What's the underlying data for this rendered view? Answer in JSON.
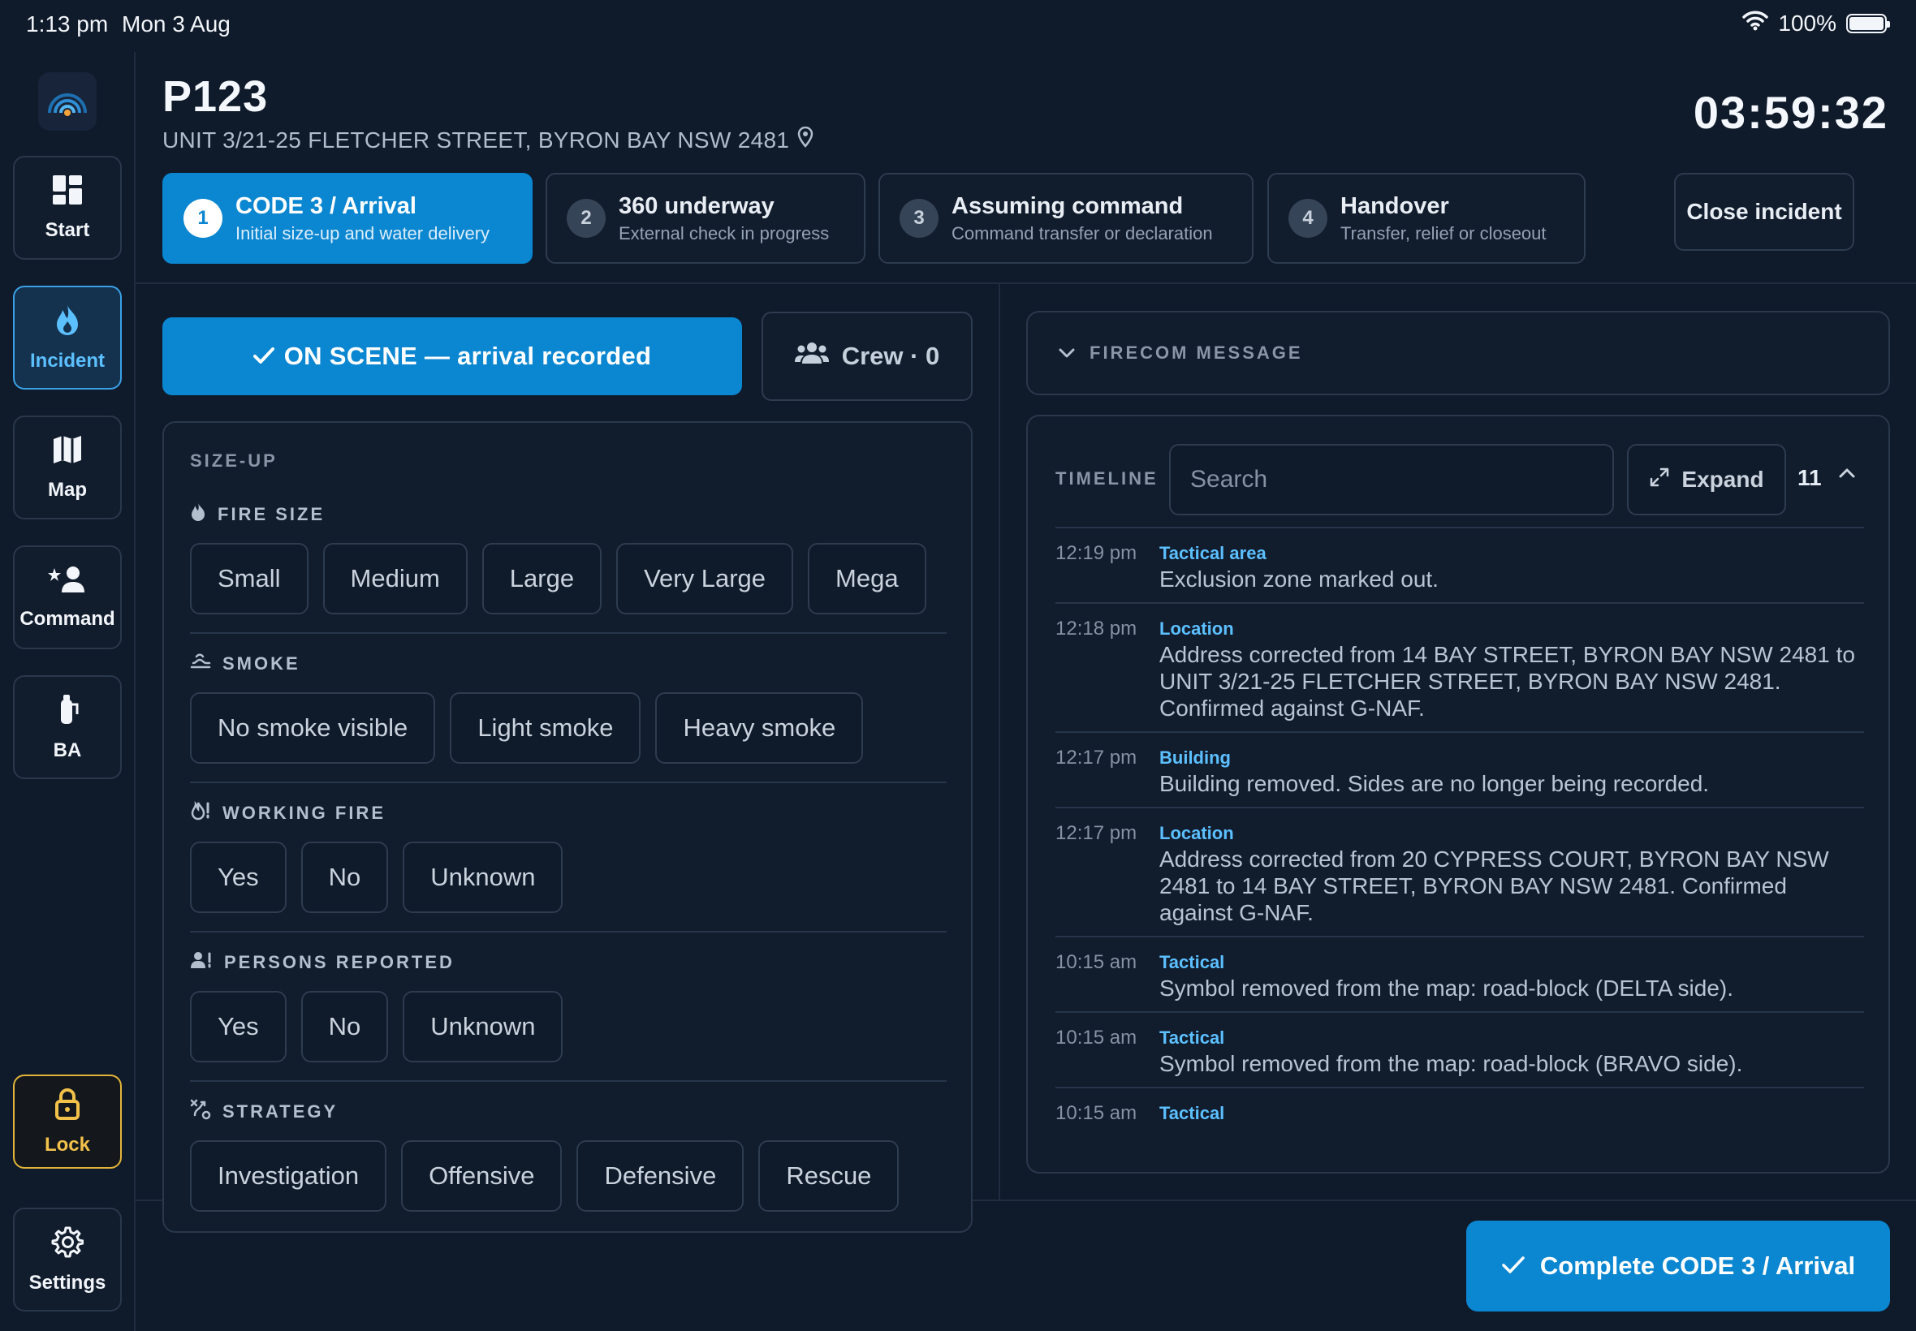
{
  "status_bar": {
    "time": "1:13 pm",
    "date": "Mon 3 Aug",
    "battery": "100%"
  },
  "sidebar": {
    "items": [
      {
        "label": "Start",
        "icon": "grid-icon"
      },
      {
        "label": "Incident",
        "icon": "flame-icon",
        "active": true
      },
      {
        "label": "Map",
        "icon": "map-icon"
      },
      {
        "label": "Command",
        "icon": "commander-icon"
      },
      {
        "label": "BA",
        "icon": "breathing-apparatus-icon"
      }
    ],
    "lock_label": "Lock",
    "settings_label": "Settings"
  },
  "header": {
    "incident_id": "P123",
    "address": "UNIT 3/21-25 FLETCHER STREET, BYRON BAY NSW 2481",
    "timer": "03:59:32"
  },
  "steps": [
    {
      "num": "1",
      "title": "CODE 3 / Arrival",
      "subtitle": "Initial size-up and water delivery",
      "active": true
    },
    {
      "num": "2",
      "title": "360 underway",
      "subtitle": "External check in progress"
    },
    {
      "num": "3",
      "title": "Assuming command",
      "subtitle": "Command transfer or declaration"
    },
    {
      "num": "4",
      "title": "Handover",
      "subtitle": "Transfer, relief or closeout"
    }
  ],
  "close_incident_label": "Close incident",
  "on_scene_label": "ON SCENE — arrival recorded",
  "crew_label": "Crew · 0",
  "sizeup": {
    "title": "SIZE-UP",
    "sections": [
      {
        "title": "FIRE SIZE",
        "icon": "flame-icon",
        "options": [
          "Small",
          "Medium",
          "Large",
          "Very Large",
          "Mega"
        ]
      },
      {
        "title": "SMOKE",
        "icon": "smoke-icon",
        "options": [
          "No smoke visible",
          "Light smoke",
          "Heavy smoke"
        ]
      },
      {
        "title": "WORKING FIRE",
        "icon": "flame-alert-icon",
        "options": [
          "Yes",
          "No",
          "Unknown"
        ]
      },
      {
        "title": "PERSONS REPORTED",
        "icon": "person-alert-icon",
        "options": [
          "Yes",
          "No",
          "Unknown"
        ]
      },
      {
        "title": "STRATEGY",
        "icon": "strategy-icon",
        "options": [
          "Investigation",
          "Offensive",
          "Defensive",
          "Rescue"
        ]
      }
    ]
  },
  "firecom": {
    "title": "FIRECOM MESSAGE"
  },
  "timeline": {
    "title": "TIMELINE",
    "search_placeholder": "Search",
    "expand_label": "Expand",
    "count": "11",
    "entries": [
      {
        "time": "12:19 pm",
        "category": "Tactical area",
        "message": "Exclusion zone marked out."
      },
      {
        "time": "12:18 pm",
        "category": "Location",
        "message": "Address corrected from 14 BAY STREET, BYRON BAY NSW 2481 to UNIT 3/21-25 FLETCHER STREET, BYRON BAY NSW 2481. Confirmed against G-NAF."
      },
      {
        "time": "12:17 pm",
        "category": "Building",
        "message": "Building removed. Sides are no longer being recorded."
      },
      {
        "time": "12:17 pm",
        "category": "Location",
        "message": "Address corrected from 20 CYPRESS COURT, BYRON BAY NSW 2481 to 14 BAY STREET, BYRON BAY NSW 2481. Confirmed against G-NAF."
      },
      {
        "time": "10:15 am",
        "category": "Tactical",
        "message": "Symbol removed from the map: road-block (DELTA side)."
      },
      {
        "time": "10:15 am",
        "category": "Tactical",
        "message": "Symbol removed from the map: road-block (BRAVO side)."
      },
      {
        "time": "10:15 am",
        "category": "Tactical",
        "message": ""
      }
    ]
  },
  "complete_label": "Complete CODE 3 / Arrival",
  "colors": {
    "background": "#0f1a2a",
    "panel": "#111c2d",
    "accent": "#0b86d1",
    "accent_text": "#5cc0ff",
    "lock": "#f2c14a"
  }
}
